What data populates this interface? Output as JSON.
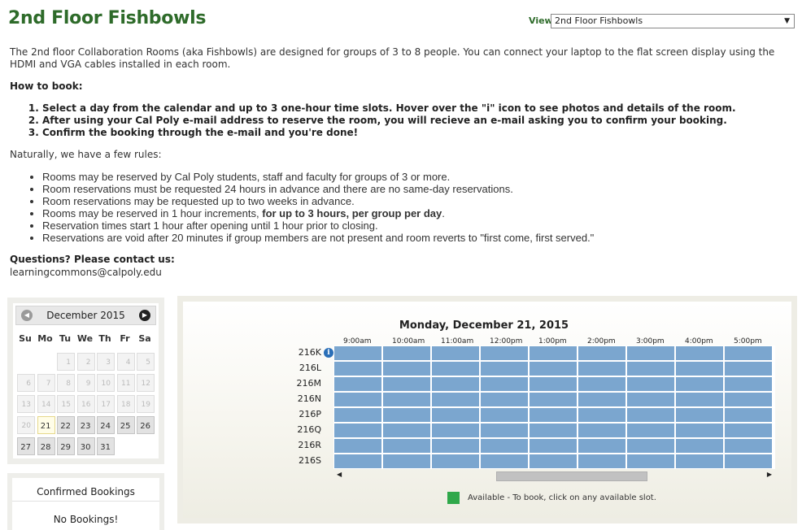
{
  "page": {
    "title": "2nd Floor Fishbowls",
    "view_label": "View:",
    "view_selected": "2nd Floor Fishbowls",
    "intro": "The 2nd floor Collaboration Rooms (aka Fishbowls) are designed for groups of 3 to 8 people. You can connect your laptop to the flat screen display using the HDMI and VGA cables installed in each room.",
    "howto_heading": "How to book:",
    "steps": [
      "Select a day from the calendar and up to 3 one-hour time slots. Hover over the \"i\" icon to see photos and details of the room.",
      "After using your Cal Poly e-mail address to reserve the room, you will recieve an e-mail asking you to confirm your booking.",
      "Confirm the booking through the e-mail and you're done!"
    ],
    "rules_intro": "Naturally, we have a few rules:",
    "rules": [
      {
        "text": "Rooms may be reserved by Cal Poly students, staff and faculty for groups of 3 or more.",
        "bold": ""
      },
      {
        "text": "Room reservations must be requested 24 hours in advance and there are no same-day reservations.",
        "bold": ""
      },
      {
        "text": "Room reservations may be requested up to two weeks in advance.",
        "bold": ""
      },
      {
        "text": "Rooms may be reserved in 1 hour increments, ",
        "bold": "for up to 3 hours, per group per day",
        "after": "."
      },
      {
        "text": "Reservation times start 1 hour after opening until 1 hour prior to closing.",
        "bold": ""
      },
      {
        "text": "Reservations are void after 20 minutes if group members are not present and room reverts to \"first come, first served.\"",
        "bold": ""
      }
    ],
    "questions_heading": "Questions? Please contact us:",
    "contact_email": "learningcommons@calpoly.edu"
  },
  "calendar": {
    "month_label": "December 2015",
    "weekdays": [
      "Su",
      "Mo",
      "Tu",
      "We",
      "Th",
      "Fr",
      "Sa"
    ],
    "first_weekday": 2,
    "days_in_month": 31,
    "today": 21,
    "bookable_from": 21
  },
  "bookings": {
    "title": "Confirmed Bookings",
    "empty_text": "No Bookings!"
  },
  "schedule": {
    "date_label": "Monday, December 21, 2015",
    "times": [
      "9:00am",
      "10:00am",
      "11:00am",
      "12:00pm",
      "1:00pm",
      "2:00pm",
      "3:00pm",
      "4:00pm",
      "5:00pm"
    ],
    "rooms": [
      "216K",
      "216L",
      "216M",
      "216N",
      "216P",
      "216Q",
      "216R",
      "216S"
    ],
    "slot_status": "available",
    "legend_text": "Available - To book, click on any available slot.",
    "colors": {
      "available_slot": "#7ba6cf",
      "legend_available": "#2fa84a",
      "title_green": "#2e6b2a"
    }
  }
}
